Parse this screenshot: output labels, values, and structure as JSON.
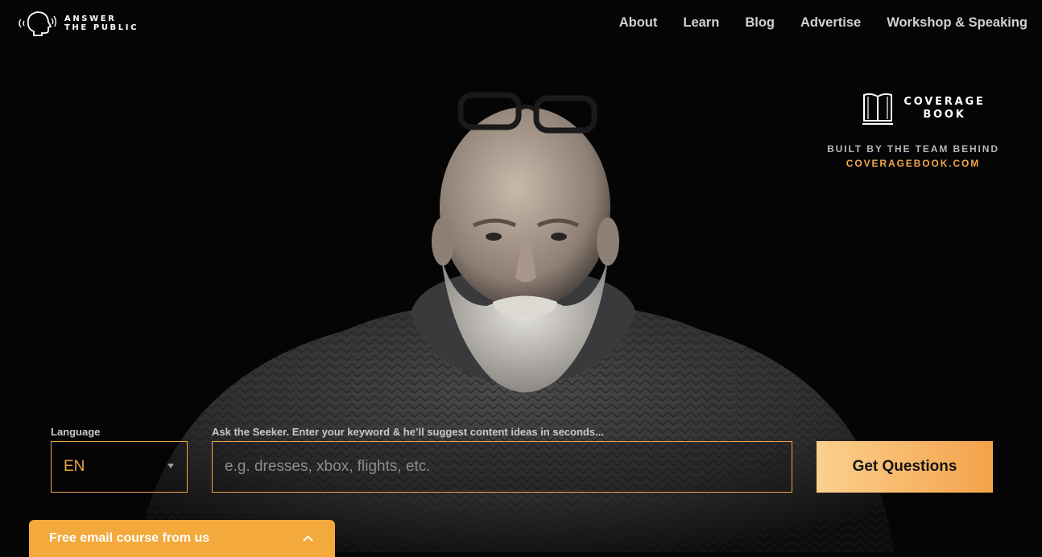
{
  "brand": {
    "line1": "ANSWER",
    "line2": "THE PUBLIC"
  },
  "nav": {
    "items": [
      "About",
      "Learn",
      "Blog",
      "Advertise",
      "Workshop & Speaking"
    ]
  },
  "coverage": {
    "line1": "COVERAGE",
    "line2": "BOOK",
    "built_by": "BUILT BY THE TEAM BEHIND",
    "link": "COVERAGEBOOK.COM"
  },
  "search": {
    "language_label": "Language",
    "language_value": "EN",
    "keyword_label": "Ask the Seeker. Enter your keyword & he’ll suggest content ideas in seconds...",
    "keyword_placeholder": "e.g. dresses, xbox, flights, etc.",
    "submit_label": "Get Questions"
  },
  "email_course": {
    "label": "Free email course from us"
  },
  "colors": {
    "accent": "#f0a548",
    "button_from": "#fbd08e",
    "button_to": "#f3a24a",
    "email_bar": "#f3a93b"
  }
}
